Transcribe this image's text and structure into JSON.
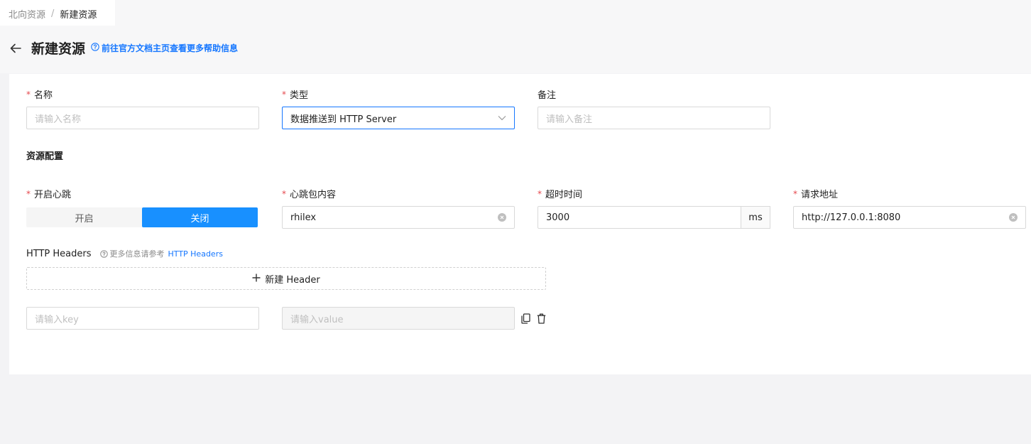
{
  "breadcrumb": {
    "parent": "北向资源",
    "separator": "/",
    "current": "新建资源"
  },
  "header": {
    "title": "新建资源",
    "help_link": "前往官方文档主页查看更多帮助信息"
  },
  "form": {
    "name": {
      "label": "名称",
      "placeholder": "请输入名称"
    },
    "type": {
      "label": "类型",
      "value": "数据推送到 HTTP Server"
    },
    "remark": {
      "label": "备注",
      "placeholder": "请输入备注"
    },
    "section_title": "资源配置",
    "heartbeat": {
      "label": "开启心跳",
      "options": [
        "开启",
        "关闭"
      ],
      "selected": "关闭"
    },
    "heartbeat_content": {
      "label": "心跳包内容",
      "value": "rhilex"
    },
    "timeout": {
      "label": "超时时间",
      "value": "3000",
      "unit": "ms"
    },
    "url": {
      "label": "请求地址",
      "value": "http://127.0.0.1:8080"
    },
    "headers": {
      "label": "HTTP Headers",
      "note": "更多信息请参考",
      "note_link": "HTTP Headers",
      "add_label": "新建 Header",
      "key_placeholder": "请输入key",
      "value_placeholder": "请输入value"
    }
  },
  "colors": {
    "accent": "#1677ff",
    "required": "#e5484d",
    "segment_active": "#1890ff"
  },
  "icons": [
    "back-arrow-icon",
    "question-circle-icon",
    "chevron-down-icon",
    "clear-circle-icon",
    "plus-icon",
    "copy-icon",
    "delete-icon"
  ]
}
